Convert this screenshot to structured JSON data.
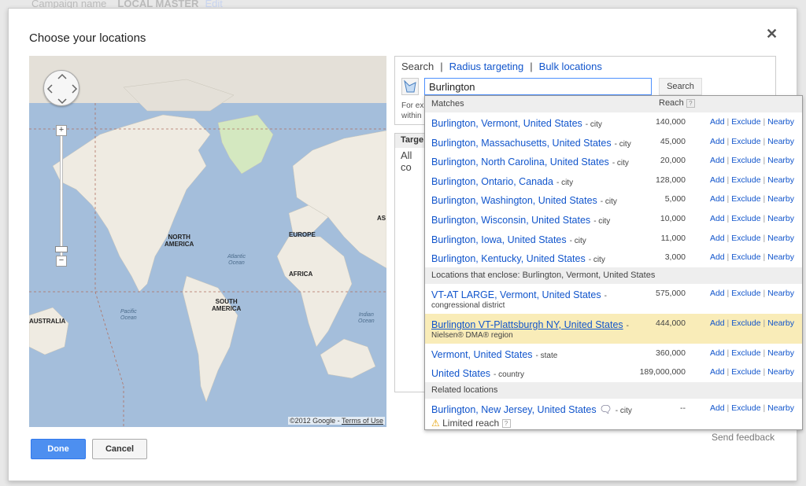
{
  "background": {
    "campaign_label": "Campaign name",
    "campaign_value": "LOCAL MASTER",
    "edit": "Edit"
  },
  "dialog": {
    "title": "Choose your locations",
    "close_icon": "close-icon"
  },
  "map": {
    "labels": {
      "north_america": "NORTH\nAMERICA",
      "south_america": "SOUTH\nAMERICA",
      "europe": "EUROPE",
      "africa": "AFRICA",
      "australia": "AUSTRALIA",
      "asia": "AS"
    },
    "oceans": {
      "atlantic": "Atlantic\nOcean",
      "pacific": "Pacific\nOcean",
      "indian": "Indian\nOcean"
    },
    "copyright": "©2012 Google - ",
    "terms": "Terms of Use",
    "zoom_in": "+",
    "zoom_out": "−"
  },
  "search": {
    "tabs": {
      "search": "Search",
      "radius": "Radius targeting",
      "bulk": "Bulk locations"
    },
    "query": "Burlington",
    "button": "Search",
    "hint_line1": "For ex",
    "hint_line2": "within"
  },
  "targeted": {
    "header": "Targe",
    "all": "All co"
  },
  "dropdown": {
    "matches_header": "Matches",
    "reach_header": "Reach",
    "help": "?",
    "matches": [
      {
        "name": "Burlington, Vermont, United States",
        "type": "- city",
        "reach": "140,000"
      },
      {
        "name": "Burlington, Massachusetts, United States",
        "type": "- city",
        "reach": "45,000"
      },
      {
        "name": "Burlington, North Carolina, United States",
        "type": "- city",
        "reach": "20,000"
      },
      {
        "name": "Burlington, Ontario, Canada",
        "type": "- city",
        "reach": "128,000"
      },
      {
        "name": "Burlington, Washington, United States",
        "type": "- city",
        "reach": "5,000"
      },
      {
        "name": "Burlington, Wisconsin, United States",
        "type": "- city",
        "reach": "10,000"
      },
      {
        "name": "Burlington, Iowa, United States",
        "type": "- city",
        "reach": "11,000"
      },
      {
        "name": "Burlington, Kentucky, United States",
        "type": "- city",
        "reach": "3,000"
      }
    ],
    "enclose_header": "Locations that enclose: Burlington, Vermont, United States",
    "enclose": [
      {
        "name": "VT-AT LARGE, Vermont, United States",
        "type": "-",
        "sub": "congressional district",
        "reach": "575,000"
      },
      {
        "name": "Burlington VT-Plattsburgh NY, United States",
        "type": "-",
        "sub": "Nielsen® DMA® region",
        "reach": "444,000"
      },
      {
        "name": "Vermont, United States",
        "type": "- state",
        "reach": "360,000"
      },
      {
        "name": "United States",
        "type": "- country",
        "reach": "189,000,000"
      }
    ],
    "related_header": "Related locations",
    "related": [
      {
        "name": "Burlington, New Jersey, United States",
        "type": "- city",
        "reach": "--",
        "warning": "Limited reach"
      }
    ],
    "actions": {
      "add": "Add",
      "exclude": "Exclude",
      "nearby": "Nearby",
      "sep": "|"
    },
    "highlight_color": "#f9ecb8"
  },
  "footer": {
    "done": "Done",
    "cancel": "Cancel",
    "feedback": "Send feedback"
  },
  "colors": {
    "link": "#1155cc",
    "primary_button": "#4d8ff0",
    "ocean": "#a4bedb",
    "land": "#efebe2"
  }
}
